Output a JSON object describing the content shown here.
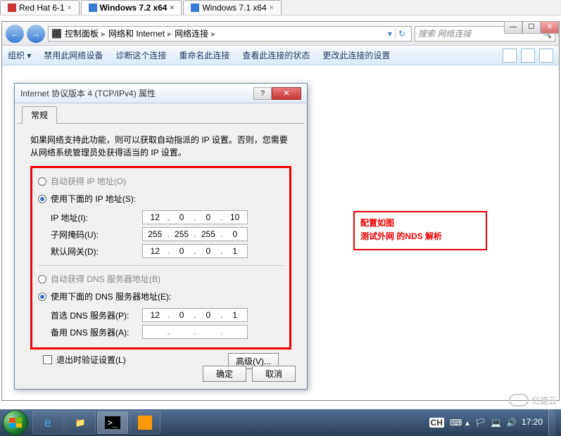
{
  "vm_tabs": {
    "t1": "Red Hat 6-1",
    "t2": "Windows 7.2 x64",
    "t3": "Windows 7.1 x64"
  },
  "window_controls": {
    "min": "—",
    "max": "☐",
    "close": "✕"
  },
  "explorer": {
    "back": "←",
    "fwd": "→",
    "breadcrumbs": {
      "root": "控制面板",
      "seg1": "网络和 Internet",
      "seg2": "网络连接"
    },
    "refresh": "↻",
    "search_placeholder": "搜索 网络连接",
    "toolbar": {
      "organize": "组织 ▾",
      "disable": "禁用此网络设备",
      "diagnose": "诊断这个连接",
      "rename": "重命名此连接",
      "status": "查看此连接的状态",
      "change": "更改此连接的设置"
    }
  },
  "dialog": {
    "title": "Internet 协议版本 4 (TCP/IPv4) 属性",
    "help": "?",
    "close": "✕",
    "tab": "常规",
    "desc": "如果网络支持此功能，则可以获取自动指派的 IP 设置。否则，您需要从网络系统管理员处获得适当的 IP 设置。",
    "radio_auto_ip": "自动获得 IP 地址(O)",
    "radio_use_ip": "使用下面的 IP 地址(S):",
    "lbl_ip": "IP 地址(I):",
    "lbl_mask": "子网掩码(U):",
    "lbl_gateway": "默认网关(D):",
    "ip": {
      "a": "12",
      "b": "0",
      "c": "0",
      "d": "10"
    },
    "mask": {
      "a": "255",
      "b": "255",
      "c": "255",
      "d": "0"
    },
    "gw": {
      "a": "12",
      "b": "0",
      "c": "0",
      "d": "1"
    },
    "radio_auto_dns": "自动获得 DNS 服务器地址(B)",
    "radio_use_dns": "使用下面的 DNS 服务器地址(E):",
    "lbl_dns1": "首选 DNS 服务器(P):",
    "lbl_dns2": "备用 DNS 服务器(A):",
    "dns1": {
      "a": "12",
      "b": "0",
      "c": "0",
      "d": "1"
    },
    "chk_validate": "退出时验证设置(L)",
    "btn_adv": "高级(V)...",
    "btn_ok": "确定",
    "btn_cancel": "取消"
  },
  "annotation": {
    "line1": "配置如图",
    "line2": "测试外网 的NDS 解析"
  },
  "tray": {
    "ime": "CH",
    "time": "17:20"
  },
  "watermark": "亿速云"
}
